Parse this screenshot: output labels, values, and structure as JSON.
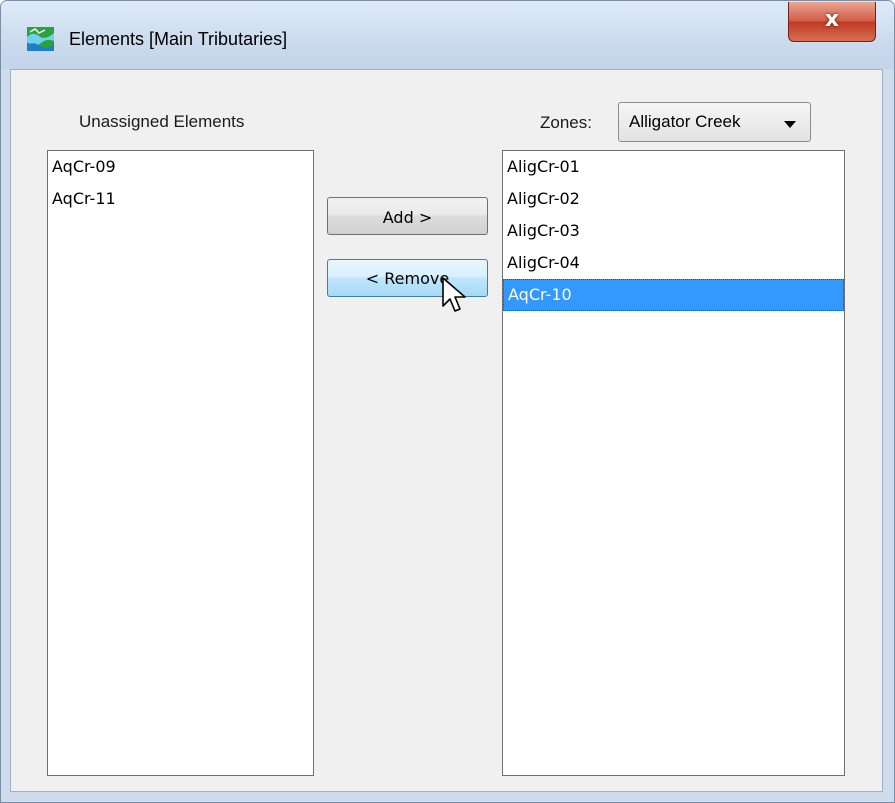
{
  "window": {
    "title": "Elements [Main Tributaries]",
    "close_glyph": "x"
  },
  "left_panel": {
    "label": "Unassigned Elements",
    "items": [
      "AqCr-09",
      "AqCr-11"
    ]
  },
  "zones": {
    "label": "Zones:",
    "selected": "Alligator Creek"
  },
  "right_panel": {
    "items": [
      "AligCr-01",
      "AligCr-02",
      "AligCr-03",
      "AligCr-04",
      "AqCr-10"
    ],
    "selected_item": "AqCr-10"
  },
  "buttons": {
    "add_label": "Add >",
    "remove_label": "< Remove"
  },
  "icons": {
    "app": "map-terrain-icon",
    "close": "close-icon",
    "dropdown": "chevron-down-icon",
    "cursor": "mouse-pointer-icon"
  },
  "colors": {
    "selection": "#3399ff",
    "close_button": "#c7503a",
    "titlebar": "#cddcee"
  }
}
